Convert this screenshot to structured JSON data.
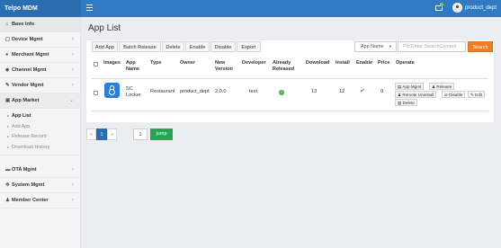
{
  "brand": "Telpo MDM",
  "user": {
    "name": "product_dept"
  },
  "sidebar": {
    "items": [
      {
        "label": "Base Info",
        "icon": "home-icon"
      },
      {
        "label": "Device Mgmt",
        "icon": "device-icon"
      },
      {
        "label": "Merchant Mgmt",
        "icon": "user-icon"
      },
      {
        "label": "Channel Mgmt",
        "icon": "users-icon"
      },
      {
        "label": "Vendor Mgmt",
        "icon": "wrench-icon"
      },
      {
        "label": "App Market",
        "icon": "store-icon"
      }
    ],
    "sub": [
      {
        "label": "App List"
      },
      {
        "label": "Add App"
      },
      {
        "label": "Release Record"
      },
      {
        "label": "Download History"
      }
    ],
    "items2": [
      {
        "label": "OTA Mgmt",
        "icon": "folder-icon"
      },
      {
        "label": "System Mgmt",
        "icon": "gear-icon"
      },
      {
        "label": "Member Center",
        "icon": "person-icon"
      }
    ]
  },
  "page": {
    "title": "App List"
  },
  "toolbar": {
    "add": "Add App",
    "batch": "Batch Release",
    "delete": "Delete",
    "enable": "Enable",
    "disable": "Disable",
    "export": "Export"
  },
  "search": {
    "field": "App Name",
    "placeholder": "Plz Enter SearchContent",
    "button": "Search"
  },
  "table": {
    "headers": {
      "images": "Images",
      "app_name": "App Name",
      "type": "Type",
      "owner": "Owner",
      "new_version": "New Version",
      "developer": "Developer",
      "already_released": "Already Released",
      "download": "Download",
      "install": "Install",
      "enable": "Enable",
      "price": "Price",
      "operate": "Operate"
    },
    "row": {
      "app_name": "SC Locker",
      "type": "Restaurant",
      "owner": "product_dept",
      "version": "2.0.0",
      "developer": "test",
      "download": "13",
      "install": "12",
      "price": "0",
      "ops": {
        "app_mgmt": "App Mgmt",
        "release": "Release",
        "remote_uninstall": "Remote Uninstall",
        "disable": "Disable",
        "edit": "Edit",
        "delete": "Delete"
      }
    }
  },
  "pagination": {
    "prev": "«",
    "page": "1",
    "next": "»",
    "jump_value": "1",
    "jump_label": "jump"
  },
  "colors": {
    "topbar": "#2f7ac0",
    "search_button": "#f27d27",
    "jump_button": "#27a652",
    "active_page": "#2a6db0"
  }
}
